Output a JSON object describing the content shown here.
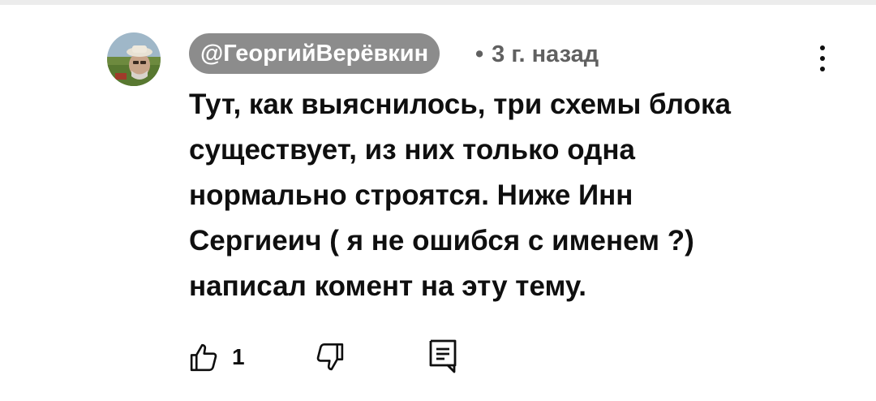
{
  "comment": {
    "author": "@ГеоргийВерёвкин",
    "separator": "•",
    "age": "3 г. назад",
    "text_lines": [
      "Тут, как выяснилось, три схемы блока",
      "существует, из них только одна",
      "нормально строятся. Ниже Инн",
      "Сергиеич ( я не ошибся с именем ?)",
      "написал комент на эту тему."
    ],
    "likes": "1"
  },
  "icons": {
    "menu": "more-vertical-icon",
    "like": "thumbs-up-icon",
    "dislike": "thumbs-down-icon",
    "reply": "reply-comment-icon"
  },
  "colors": {
    "author_chip": "#8c8c8c",
    "meta_text": "#606060",
    "text": "#0f0f0f"
  }
}
